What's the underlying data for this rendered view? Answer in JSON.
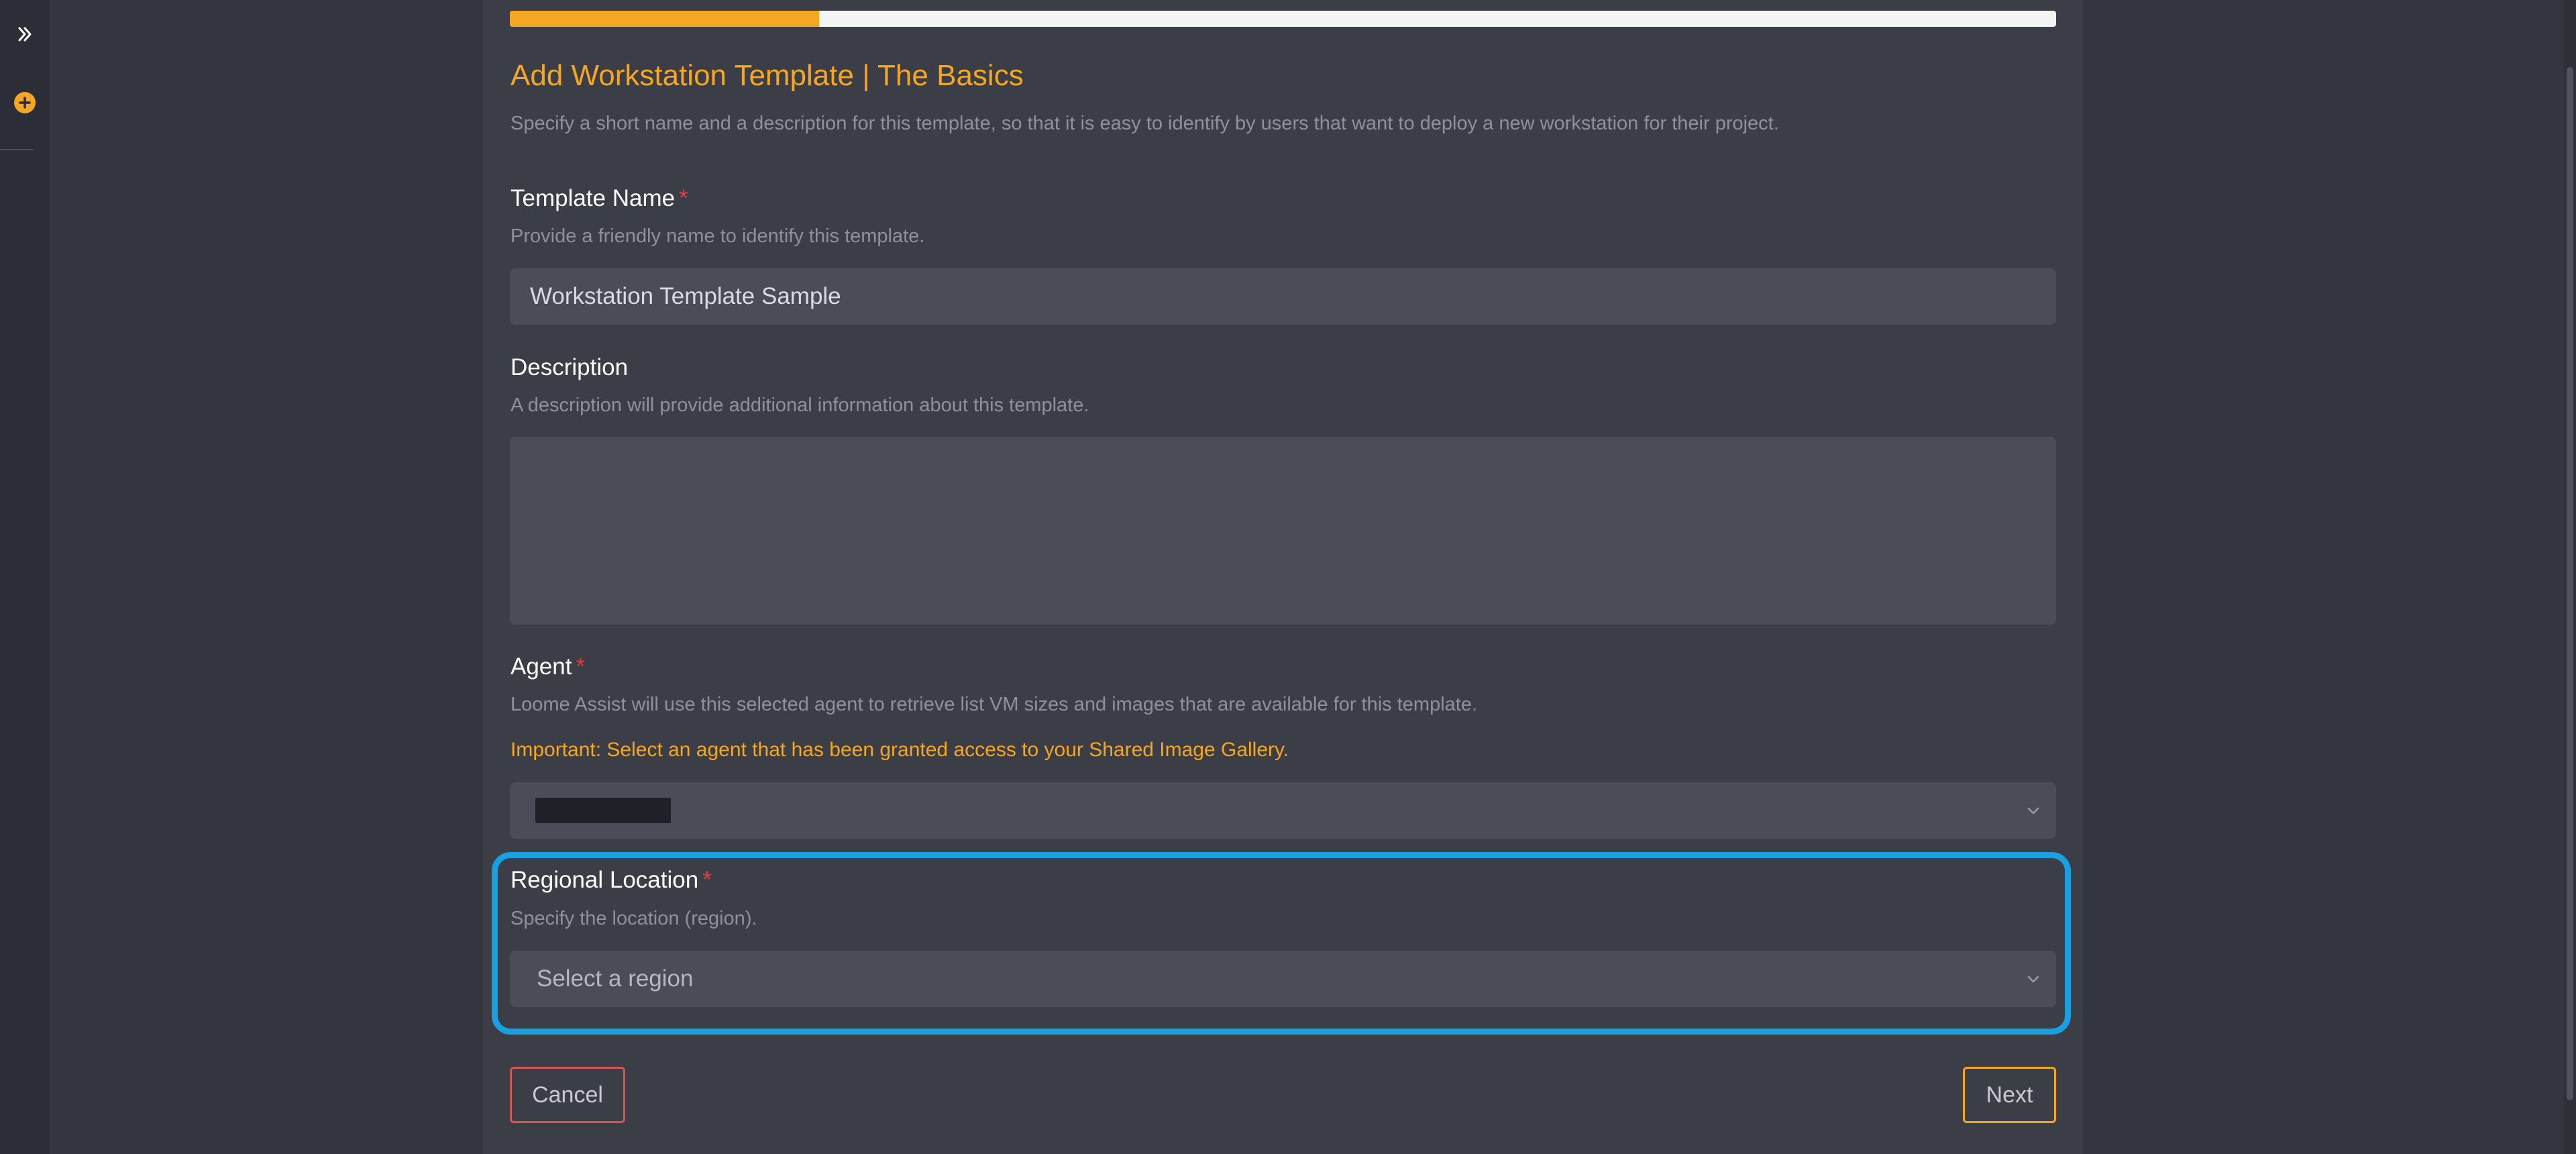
{
  "progress": {
    "fraction": 0.2
  },
  "header": {
    "title": "Add Workstation Template | The Basics",
    "subtitle": "Specify a short name and a description for this template, so that it is easy to identify by users that want to deploy a new workstation for their project."
  },
  "form": {
    "template_name": {
      "label": "Template Name",
      "required_mark": "*",
      "help": "Provide a friendly name to identify this template.",
      "value": "Workstation Template Sample"
    },
    "description": {
      "label": "Description",
      "help": "A description will provide additional information about this template.",
      "value": ""
    },
    "agent": {
      "label": "Agent",
      "required_mark": "*",
      "help": "Loome Assist will use this selected agent to retrieve list VM sizes and images that are available for this template.",
      "warning": "Important: Select an agent that has been granted access to your Shared Image Gallery."
    },
    "region": {
      "label": "Regional Location",
      "required_mark": "*",
      "help": "Specify the location (region).",
      "placeholder": "Select a region"
    }
  },
  "buttons": {
    "cancel": "Cancel",
    "next": "Next"
  },
  "colors": {
    "accent": "#f5a623",
    "highlight": "#1aa0e0",
    "danger": "#d9534f",
    "background": "#33363f",
    "panel": "#3b3e47"
  },
  "icons": {
    "expand": "double-chevron-right-icon",
    "add": "plus-circle-icon",
    "select": "chevron-down-icon"
  }
}
